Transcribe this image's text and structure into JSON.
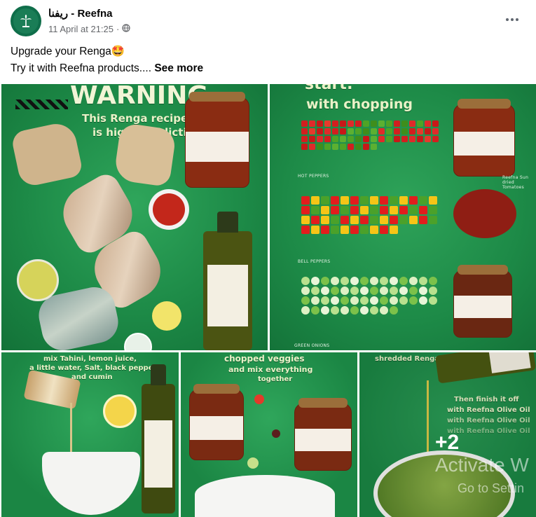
{
  "post": {
    "page_name": "ريفنا - Reefna",
    "timestamp": "11 April at 21:25",
    "separator": "·",
    "privacy_icon": "globe-icon",
    "more_icon": "more-options-icon",
    "text_line1": "Upgrade your Renga🤩",
    "text_line2": "Try it with Reefna products....",
    "see_more": "See more"
  },
  "tiles": {
    "t1": {
      "headline": "WARNING",
      "sub1": "This Renga recipe",
      "sub2": "is highly addictive!"
    },
    "t2": {
      "headline": "start:",
      "sub": "with chopping",
      "label1": "HOT PEPPERS",
      "label2": "BELL PEPPERS",
      "label3": "GREEN ONIONS",
      "side_label": "Reefna Sun dried Tomatoes"
    },
    "t3": {
      "line1": "mix Tahini, lemon juice,",
      "line2": "a little water, Salt, black pepper,",
      "line3": "and cumin"
    },
    "t4": {
      "line1": "chopped veggies",
      "line2": "and mix everything",
      "line3": "together"
    },
    "t5": {
      "top": "shredded Renga",
      "line1": "Then finish it off",
      "line2": "with Reefna Olive Oil",
      "line3": "with Reefna Olive Oil",
      "line4": "with Reefna Olive Oil",
      "more_count": "+2",
      "watermark1": "Activate W",
      "watermark2": "Go to Settin"
    }
  },
  "colors": {
    "brand_green": "#1d8a47",
    "text_secondary": "#65676b"
  }
}
